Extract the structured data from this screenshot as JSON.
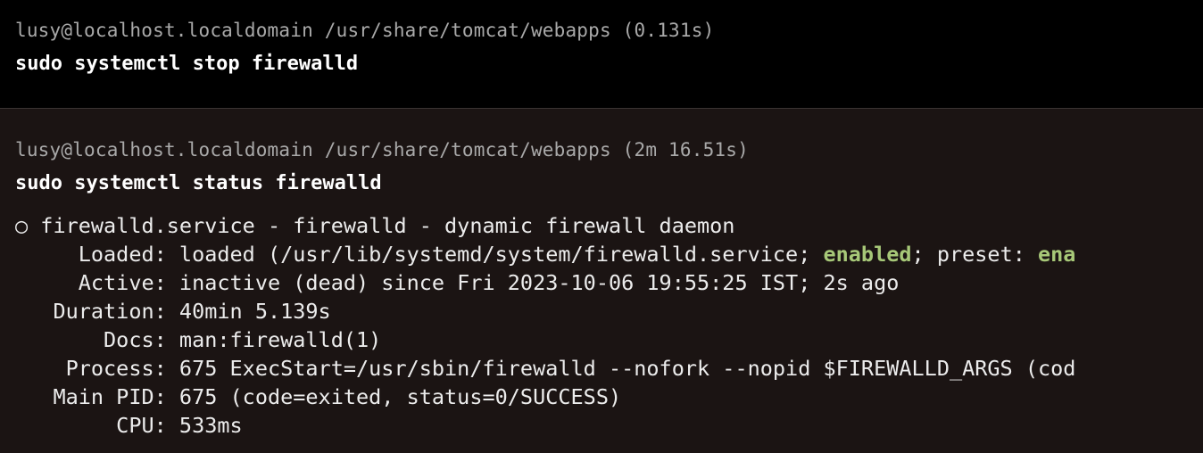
{
  "blocks": [
    {
      "prompt": "lusy@localhost.localdomain /usr/share/tomcat/webapps (0.131s)",
      "command": "sudo systemctl stop firewalld"
    },
    {
      "prompt": "lusy@localhost.localdomain /usr/share/tomcat/webapps (2m 16.51s)",
      "command": "sudo systemctl status firewalld",
      "output": {
        "header": "○ firewalld.service - firewalld - dynamic firewall daemon",
        "loaded_prefix": "     Loaded: loaded (/usr/lib/systemd/system/firewalld.service; ",
        "loaded_enabled": "enabled",
        "loaded_mid": "; preset: ",
        "loaded_tail": "ena",
        "active": "     Active: inactive (dead) since Fri 2023-10-06 19:55:25 IST; 2s ago",
        "duration": "   Duration: 40min 5.139s",
        "docs": "       Docs: man:firewalld(1)",
        "process": "    Process: 675 ExecStart=/usr/sbin/firewalld --nofork --nopid $FIREWALLD_ARGS (cod",
        "main_pid": "   Main PID: 675 (code=exited, status=0/SUCCESS)",
        "cpu": "        CPU: 533ms"
      }
    }
  ],
  "colors": {
    "background_first": "#000000",
    "background_second": "#1b1413",
    "prompt": "#a9a9a9",
    "command": "#ffffff",
    "output": "#ececec",
    "enabled": "#a7c878"
  }
}
